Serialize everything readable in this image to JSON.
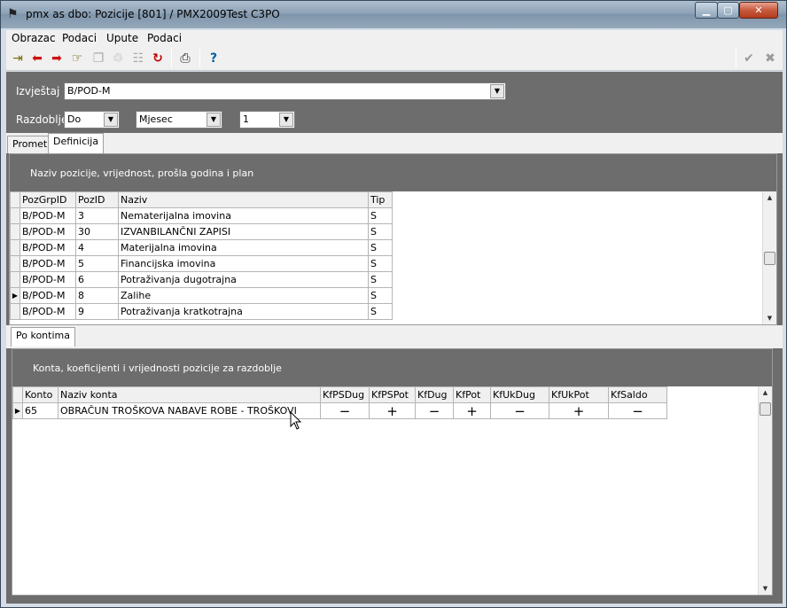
{
  "window": {
    "title": "pmx as dbo: Pozicije [801] / PMX2009Test C3PO",
    "icon": "app-icon"
  },
  "menu": [
    "Obrazac",
    "Podaci",
    "Upute",
    "Podaci"
  ],
  "toolbar": {
    "icons": [
      "exit-door-icon",
      "arrow-left-icon",
      "arrow-right-icon",
      "pointing-hand-icon",
      "copy-icon",
      "trash-icon",
      "document-icon",
      "refresh-icon",
      "print-icon",
      "help-icon",
      "confirm-check-icon",
      "cancel-x-icon"
    ]
  },
  "filters": {
    "izvjestaj_label": "Izvještaj",
    "izvjestaj_value": "B/POD-M",
    "razdoblje_label": "Razdoblje",
    "razdoblje_mode": "Do",
    "razdoblje_period": "Mjesec",
    "razdoblje_number": "1"
  },
  "tabs": [
    {
      "label": "Promet",
      "active": false
    },
    {
      "label": "Definicija",
      "active": true
    }
  ],
  "positions": {
    "header": "Naziv pozicije, vrijednost, prošla godina i plan",
    "columns": [
      "PozGrpID",
      "PozID",
      "Naziv",
      "Tip"
    ],
    "current_row": 5,
    "rows": [
      [
        "B/POD-M",
        "3",
        "Nematerijalna imovina",
        "S"
      ],
      [
        "B/POD-M",
        "30",
        "IZVANBILANČNI ZAPISI",
        "S"
      ],
      [
        "B/POD-M",
        "4",
        "Materijalna imovina",
        "S"
      ],
      [
        "B/POD-M",
        "5",
        "Financijska imovina",
        "S"
      ],
      [
        "B/POD-M",
        "6",
        "Potraživanja dugotrajna",
        "S"
      ],
      [
        "B/POD-M",
        "8",
        "Zalihe",
        "S"
      ],
      [
        "B/POD-M",
        "9",
        "Potraživanja kratkotrajna",
        "S"
      ]
    ]
  },
  "subtab": {
    "label": "Po kontima"
  },
  "accounts": {
    "header": "Konta, koeficijenti i vrijednosti pozicije za razdoblje",
    "columns": [
      "Konto",
      "Naziv konta",
      "KfPSDug",
      "KfPSPot",
      "KfDug",
      "KfPot",
      "KfUkDug",
      "KfUkPot",
      "KfSaldo"
    ],
    "rows": [
      [
        "65",
        "OBRAČUN TROŠKOVA NABAVE ROBE - TROŠKOVI",
        "−",
        "+",
        "−",
        "+",
        "−",
        "+",
        "−"
      ]
    ]
  },
  "colors": {
    "gray_frame": "#6d6d6d",
    "titlebar": "#8ea2b6"
  }
}
